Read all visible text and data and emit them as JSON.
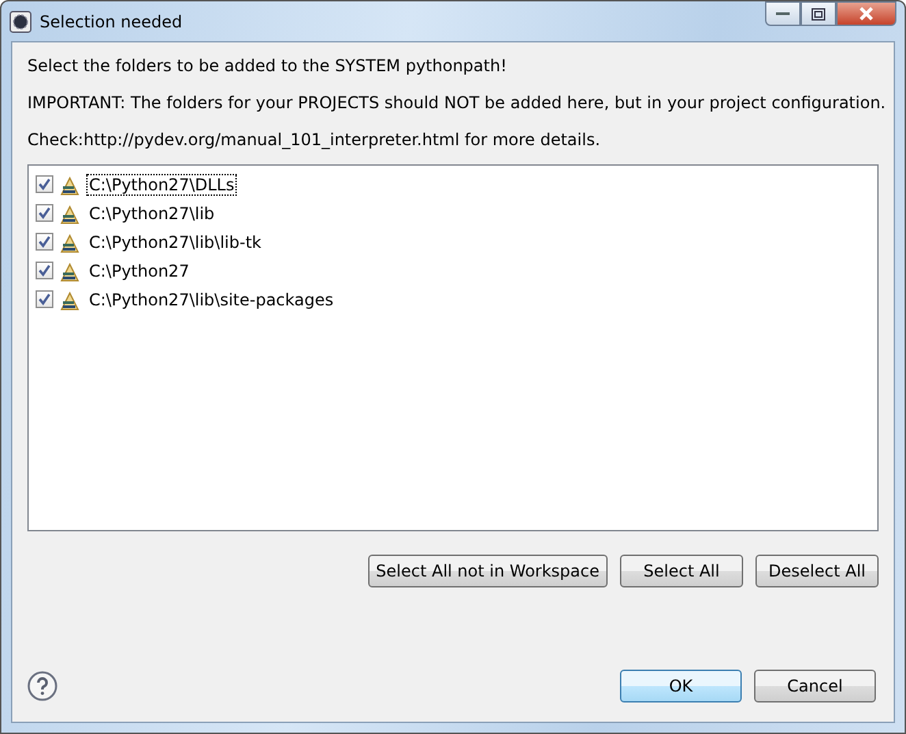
{
  "window": {
    "title": "Selection needed"
  },
  "messages": [
    "Select the folders to be added to the SYSTEM pythonpath!",
    "IMPORTANT: The folders for your PROJECTS should NOT be added here, but in your project configuration.",
    "Check:http://pydev.org/manual_101_interpreter.html for more details."
  ],
  "folders": [
    {
      "label": "C:\\Python27\\DLLs",
      "checked": true,
      "focused": true
    },
    {
      "label": "C:\\Python27\\lib",
      "checked": true,
      "focused": false
    },
    {
      "label": "C:\\Python27\\lib\\lib-tk",
      "checked": true,
      "focused": false
    },
    {
      "label": "C:\\Python27",
      "checked": true,
      "focused": false
    },
    {
      "label": "C:\\Python27\\lib\\site-packages",
      "checked": true,
      "focused": false
    }
  ],
  "selection_buttons": [
    "Select All not in Workspace",
    "Select All",
    "Deselect All"
  ],
  "dialog_buttons": [
    {
      "label": "OK",
      "default": true
    },
    {
      "label": "Cancel",
      "default": false
    }
  ]
}
